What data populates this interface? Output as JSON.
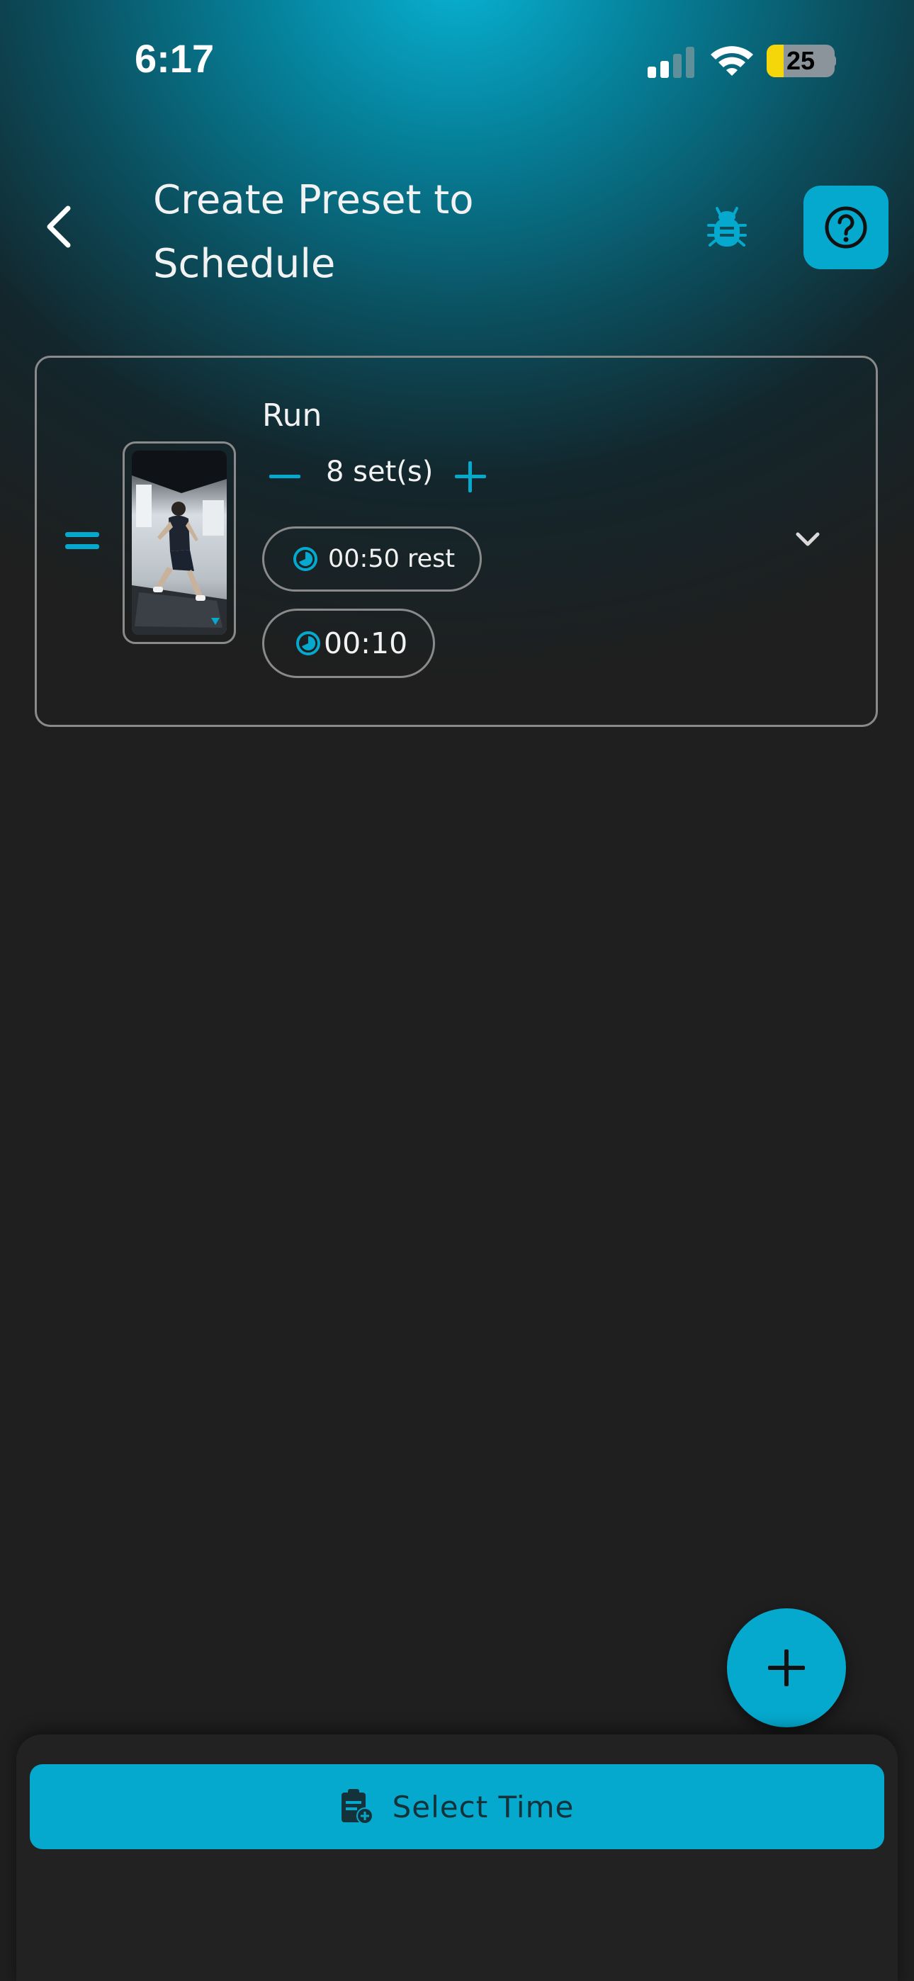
{
  "status_bar": {
    "time": "6:17",
    "battery_percent": "25",
    "battery_level": 0.25,
    "signal_bars_active": 2,
    "signal_bars_total": 4
  },
  "header": {
    "title": "Create Preset to Schedule",
    "back_icon": "chevron-left-icon",
    "bug_icon": "bug-icon",
    "help_icon": "question-circle-icon"
  },
  "exercise": {
    "name": "Run",
    "sets_label": "8 set(s)",
    "rest_label": "00:50 rest",
    "duration_label": "00:10",
    "thumbnail": "treadmill-runner-image"
  },
  "fab": {
    "icon": "plus-icon"
  },
  "footer": {
    "select_time_label": "Select Time",
    "select_time_icon": "clipboard-add-icon"
  },
  "colors": {
    "accent": "#05a9cd",
    "background": "#1f1f1f",
    "card_border": "#8a8a8a"
  }
}
